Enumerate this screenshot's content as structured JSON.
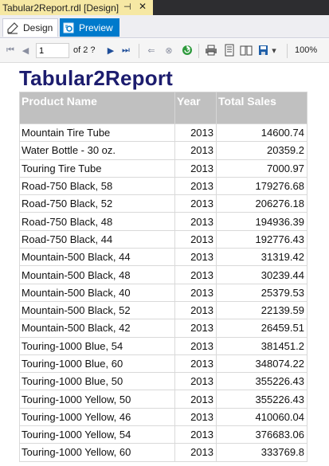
{
  "document_tab": {
    "title": "Tabular2Report.rdl [Design]",
    "pin_icon": "pin-icon",
    "close_icon": "close-icon"
  },
  "view_tabs": {
    "design": "Design",
    "preview": "Preview"
  },
  "toolbar": {
    "page_value": "1",
    "page_of": "of 2 ?",
    "zoom": "100%",
    "icons": [
      "first-page-icon",
      "previous-page-icon",
      "next-page-icon",
      "last-page-icon",
      "back-icon",
      "stop-icon",
      "refresh-icon",
      "print-icon",
      "print-layout-icon",
      "page-setup-icon",
      "export-icon"
    ]
  },
  "report": {
    "title": "Tabular2Report",
    "columns": [
      "Product Name",
      "Year",
      "Total Sales"
    ],
    "rows": [
      [
        "Mountain Tire Tube",
        "2013",
        "14600.74"
      ],
      [
        "Water Bottle - 30 oz.",
        "2013",
        "20359.2"
      ],
      [
        "Touring Tire Tube",
        "2013",
        "7000.97"
      ],
      [
        "Road-750 Black, 58",
        "2013",
        "179276.68"
      ],
      [
        "Road-750 Black, 52",
        "2013",
        "206276.18"
      ],
      [
        "Road-750 Black, 48",
        "2013",
        "194936.39"
      ],
      [
        "Road-750 Black, 44",
        "2013",
        "192776.43"
      ],
      [
        "Mountain-500 Black, 44",
        "2013",
        "31319.42"
      ],
      [
        "Mountain-500 Black, 48",
        "2013",
        "30239.44"
      ],
      [
        "Mountain-500 Black, 40",
        "2013",
        "25379.53"
      ],
      [
        "Mountain-500 Black, 52",
        "2013",
        "22139.59"
      ],
      [
        "Mountain-500 Black, 42",
        "2013",
        "26459.51"
      ],
      [
        "Touring-1000 Blue, 54",
        "2013",
        "381451.2"
      ],
      [
        "Touring-1000 Blue, 60",
        "2013",
        "348074.22"
      ],
      [
        "Touring-1000 Blue, 50",
        "2013",
        "355226.43"
      ],
      [
        "Touring-1000 Yellow, 50",
        "2013",
        "355226.43"
      ],
      [
        "Touring-1000 Yellow, 46",
        "2013",
        "410060.04"
      ],
      [
        "Touring-1000 Yellow, 54",
        "2013",
        "376683.06"
      ],
      [
        "Touring-1000 Yellow, 60",
        "2013",
        "333769.8"
      ]
    ]
  },
  "colors": {
    "tab_active": "#f6e8a4",
    "preview_tab": "#007acc",
    "header_bg": "#c0c0c0",
    "title": "#1c1c6e"
  }
}
